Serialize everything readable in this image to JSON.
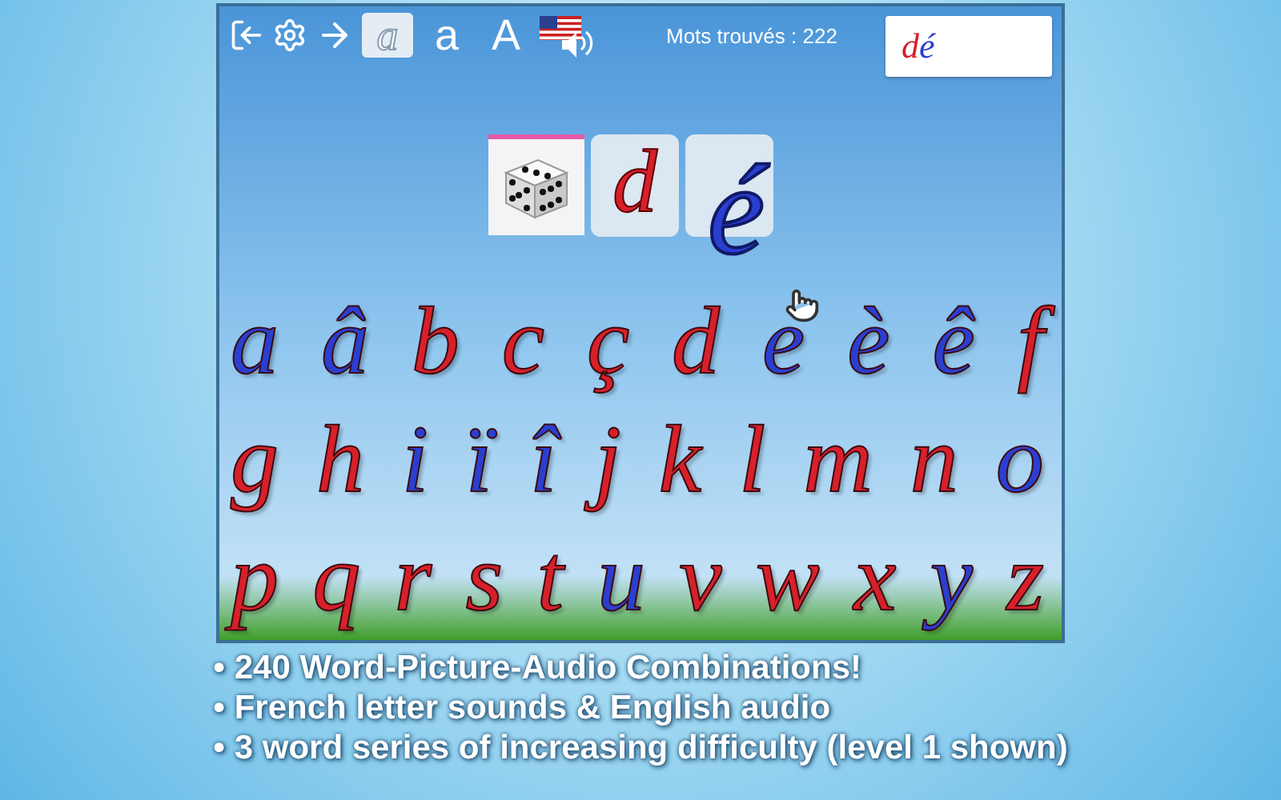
{
  "toolbar": {
    "font_buttons": [
      {
        "label": "a",
        "kind": "cursive",
        "selected": true
      },
      {
        "label": "a",
        "kind": "script",
        "selected": false
      },
      {
        "label": "A",
        "kind": "capital",
        "selected": false
      }
    ],
    "score": "Mots trouvés : 222",
    "word_card": [
      {
        "letter": "d",
        "color": "#d7202a"
      },
      {
        "letter": "é",
        "color": "#2a3fd0"
      }
    ]
  },
  "word_slots": [
    {
      "filled": true,
      "letter": "d",
      "color": "#d7202a"
    },
    {
      "filled": false
    }
  ],
  "dragged_letter": {
    "letter": "é",
    "color": "#2a3fd0"
  },
  "alphabet": [
    [
      {
        "letter": "a",
        "color": "#2a3fd0"
      },
      {
        "letter": "â",
        "color": "#2a3fd0"
      },
      {
        "letter": "b",
        "color": "#d7202a"
      },
      {
        "letter": "c",
        "color": "#d7202a"
      },
      {
        "letter": "ç",
        "color": "#d7202a"
      },
      {
        "letter": "d",
        "color": "#d7202a"
      },
      {
        "letter": "e",
        "color": "#2a3fd0"
      },
      {
        "letter": "è",
        "color": "#2a3fd0"
      },
      {
        "letter": "ê",
        "color": "#2a3fd0"
      },
      {
        "letter": "f",
        "color": "#d7202a"
      }
    ],
    [
      {
        "letter": "g",
        "color": "#d7202a"
      },
      {
        "letter": "h",
        "color": "#d7202a"
      },
      {
        "letter": "i",
        "color": "#2a3fd0"
      },
      {
        "letter": "ï",
        "color": "#2a3fd0"
      },
      {
        "letter": "î",
        "color": "#2a3fd0"
      },
      {
        "letter": "j",
        "color": "#d7202a"
      },
      {
        "letter": "k",
        "color": "#d7202a"
      },
      {
        "letter": "l",
        "color": "#d7202a"
      },
      {
        "letter": "m",
        "color": "#d7202a"
      },
      {
        "letter": "n",
        "color": "#d7202a"
      },
      {
        "letter": "o",
        "color": "#2a3fd0"
      }
    ],
    [
      {
        "letter": "p",
        "color": "#d7202a"
      },
      {
        "letter": "q",
        "color": "#d7202a"
      },
      {
        "letter": "r",
        "color": "#d7202a"
      },
      {
        "letter": "s",
        "color": "#d7202a"
      },
      {
        "letter": "t",
        "color": "#d7202a"
      },
      {
        "letter": "u",
        "color": "#2a3fd0"
      },
      {
        "letter": "v",
        "color": "#d7202a"
      },
      {
        "letter": "w",
        "color": "#d7202a"
      },
      {
        "letter": "x",
        "color": "#d7202a"
      },
      {
        "letter": "y",
        "color": "#2a3fd0"
      },
      {
        "letter": "z",
        "color": "#d7202a"
      }
    ]
  ],
  "features": [
    "• **240** Word-Picture-Audio Combinations!",
    "• French letter sounds & English audio",
    "• 3 word series of increasing difficulty (level 1 shown)"
  ]
}
